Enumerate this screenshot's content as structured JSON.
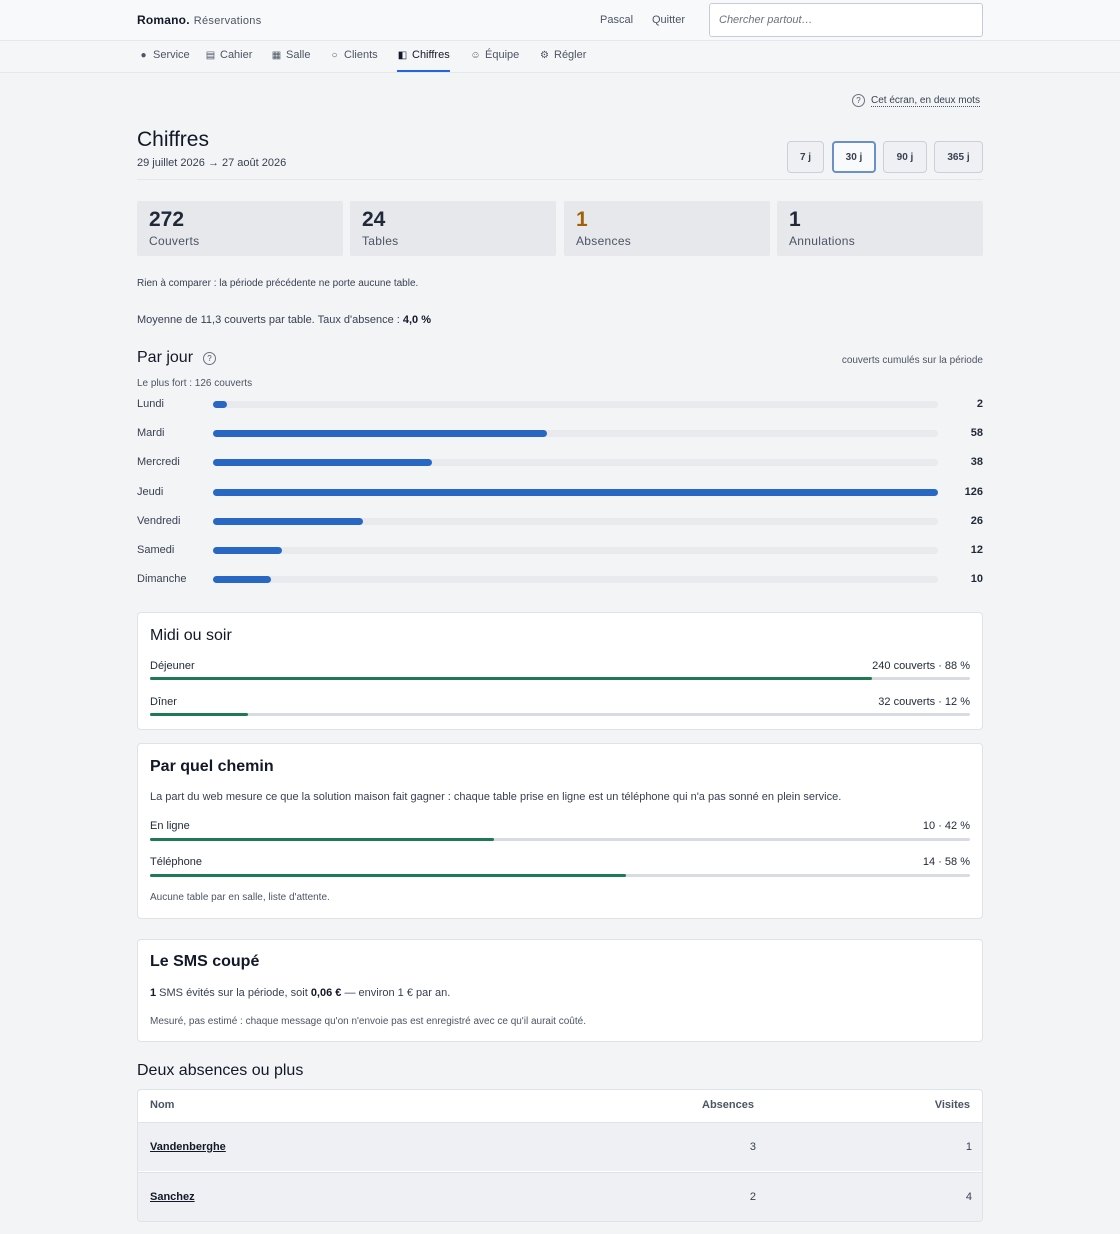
{
  "header": {
    "brand": "Romano.",
    "section": "Réservations",
    "user": "Pascal",
    "logout": "Quitter",
    "search_placeholder": "Chercher partout…"
  },
  "nav": {
    "items": [
      {
        "label": "Service",
        "icon": "dot-icon"
      },
      {
        "label": "Cahier",
        "icon": "list-icon"
      },
      {
        "label": "Salle",
        "icon": "grid-icon"
      },
      {
        "label": "Clients",
        "icon": "circle-icon"
      },
      {
        "label": "Chiffres",
        "icon": "half-square-icon",
        "active": true
      },
      {
        "label": "Équipe",
        "icon": "smile-icon"
      },
      {
        "label": "Régler",
        "icon": "gear-icon"
      }
    ]
  },
  "help": {
    "label": "Cet écran, en deux mots",
    "icon": "question-icon"
  },
  "page": {
    "title": "Chiffres",
    "date_range": "29 juillet 2026 → 27 août 2026",
    "periods": [
      "7 j",
      "30 j",
      "90 j",
      "365 j"
    ],
    "active_period": "30 j"
  },
  "stats": [
    {
      "value": "272",
      "label": "Couverts"
    },
    {
      "value": "24",
      "label": "Tables"
    },
    {
      "value": "1",
      "label": "Absences",
      "color": "#a16207"
    },
    {
      "value": "1",
      "label": "Annulations"
    }
  ],
  "compare_note": "Rien à comparer : la période précédente ne porte aucune table.",
  "average": {
    "text": "Moyenne de 11,3 couverts par table. Taux d'absence : ",
    "rate": "4,0 %"
  },
  "by_day": {
    "title": "Par jour",
    "hint": "couverts cumulés sur la période",
    "peak": "Le plus fort : 126 couverts",
    "max": 126,
    "days": [
      {
        "label": "Lundi",
        "value": 2
      },
      {
        "label": "Mardi",
        "value": 58
      },
      {
        "label": "Mercredi",
        "value": 38
      },
      {
        "label": "Jeudi",
        "value": 126
      },
      {
        "label": "Vendredi",
        "value": 26
      },
      {
        "label": "Samedi",
        "value": 12
      },
      {
        "label": "Dimanche",
        "value": 10
      }
    ]
  },
  "meal": {
    "title": "Midi ou soir",
    "rows": [
      {
        "label": "Déjeuner",
        "value": "240 couverts · 88 %",
        "share": 0.88
      },
      {
        "label": "Dîner",
        "value": "32 couverts · 12 %",
        "share": 0.12
      }
    ]
  },
  "channel": {
    "title": "Par quel chemin",
    "intro": "La part du web mesure ce que la solution maison fait gagner : chaque table prise en ligne est un téléphone qui n'a pas sonné en plein service.",
    "rows": [
      {
        "label": "En ligne",
        "value": "10 · 42 %",
        "share": 0.42
      },
      {
        "label": "Téléphone",
        "value": "14 · 58 %",
        "share": 0.58
      }
    ],
    "footnote": "Aucune table par en salle, liste d'attente."
  },
  "sms": {
    "title": "Le SMS coupé",
    "count": "1",
    "text_a": " SMS évités sur la période, soit ",
    "amount": "0,06 €",
    "text_b": " — environ 1 € par an.",
    "footnote": "Mesuré, pas estimé : chaque message qu'on n'envoie pas est enregistré avec ce qu'il aurait coûté."
  },
  "absentees": {
    "title": "Deux absences ou plus",
    "columns": [
      "Nom",
      "Absences",
      "Visites"
    ],
    "rows": [
      {
        "name": "Vandenberghe",
        "absences": "3",
        "visits": "1"
      },
      {
        "name": "Sanchez",
        "absences": "2",
        "visits": "4"
      }
    ]
  }
}
